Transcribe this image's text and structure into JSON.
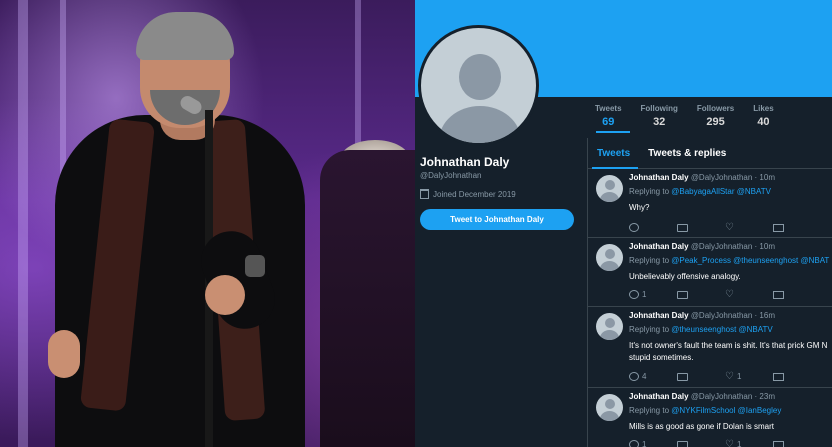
{
  "profile": {
    "name": "Johnathan Daly",
    "handle": "@DalyJohnathan",
    "joined": "Joined December 2019",
    "tweet_button": "Tweet to Johnathan Daly"
  },
  "stats": [
    {
      "label": "Tweets",
      "value": "69"
    },
    {
      "label": "Following",
      "value": "32"
    },
    {
      "label": "Followers",
      "value": "295"
    },
    {
      "label": "Likes",
      "value": "40"
    }
  ],
  "tabs": [
    "Tweets",
    "Tweets & replies"
  ],
  "tweets": [
    {
      "name": "Johnathan Daly",
      "meta": "@DalyJohnathan · 10m",
      "replying_prefix": "Replying to ",
      "mentions": "@BabyagaAllStar @NBATV",
      "text": [
        "Why?"
      ],
      "reply_count": "",
      "retweet_count": "",
      "like_count": ""
    },
    {
      "name": "Johnathan Daly",
      "meta": "@DalyJohnathan · 10m",
      "replying_prefix": "Replying to ",
      "mentions": "@Peak_Process @theunseenghost @NBAT",
      "text": [
        "Unbelievably offensive analogy."
      ],
      "reply_count": "1",
      "retweet_count": "",
      "like_count": ""
    },
    {
      "name": "Johnathan Daly",
      "meta": "@DalyJohnathan · 16m",
      "replying_prefix": "Replying to ",
      "mentions": "@theunseenghost @NBATV",
      "text": [
        "It's not owner's fault the team is shit. It's that prick GM N",
        "stupid sometimes."
      ],
      "reply_count": "4",
      "retweet_count": "",
      "like_count": "1"
    },
    {
      "name": "Johnathan Daly",
      "meta": "@DalyJohnathan · 23m",
      "replying_prefix": "Replying to ",
      "mentions": "@NYKFilmSchool @IanBegley",
      "text": [
        "Mills is as good as gone if Dolan is smart"
      ],
      "reply_count": "1",
      "retweet_count": "",
      "like_count": "1"
    }
  ],
  "colors": {
    "accent": "#1da1f2",
    "background": "#15202b",
    "muted": "#8899a6"
  },
  "icons": [
    "calendar-icon",
    "reply-icon",
    "retweet-icon",
    "like-icon",
    "message-icon"
  ]
}
